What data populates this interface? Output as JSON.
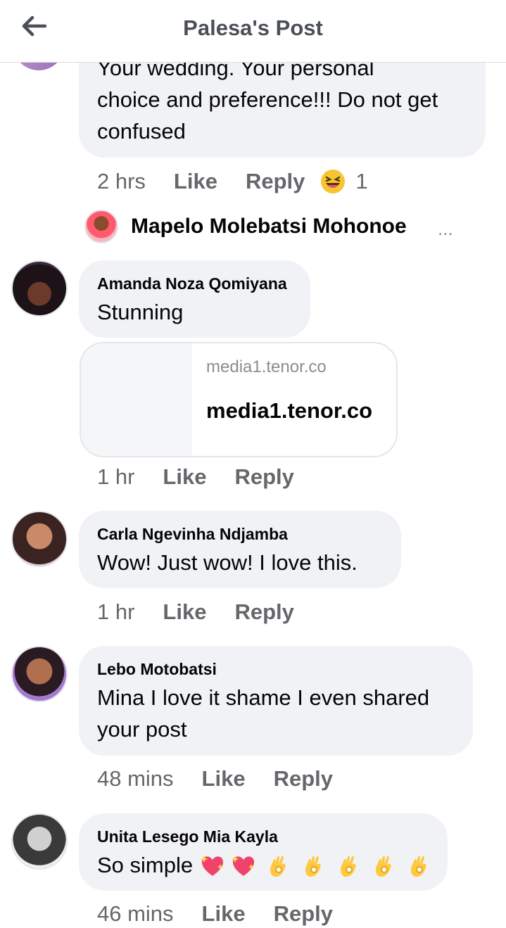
{
  "header": {
    "title": "Palesa's Post"
  },
  "first_comment": {
    "lines": [
      "Your wedding. Your personal",
      "choice and preference!!! Do not get",
      "confused"
    ],
    "time": "2 hrs",
    "like": "Like",
    "reply": "Reply",
    "reaction_count": "1"
  },
  "reply_preview": {
    "name": "Mapelo Molebatsi Mohonoe",
    "more": "..."
  },
  "comments": [
    {
      "name": "Amanda Noza Qomiyana",
      "lines": [
        "Stunning"
      ],
      "time": "1 hr",
      "like": "Like",
      "reply": "Reply",
      "link": {
        "domain": "media1.tenor.co",
        "title": "media1.tenor.co"
      }
    },
    {
      "name": "Carla Ngevinha Ndjamba",
      "lines": [
        "Wow! Just wow! I love this."
      ],
      "time": "1 hr",
      "like": "Like",
      "reply": "Reply"
    },
    {
      "name": "Lebo Motobatsi",
      "lines": [
        "Mina I love it shame I even shared",
        "your post"
      ],
      "time": "48 mins",
      "like": "Like",
      "reply": "Reply"
    },
    {
      "name": "Unita Lesego Mia Kayla",
      "lines": [
        "So simple"
      ],
      "time": "46 mins",
      "like": "Like",
      "reply": "Reply"
    }
  ],
  "colors": {
    "bubble": "#f0f2f5",
    "meta": "#65676b",
    "header_title": "#4b4f56"
  },
  "icons": [
    "back-arrow-icon",
    "laughing-reaction-icon",
    "sparkling-heart-emoji",
    "ok-hand-emoji"
  ]
}
